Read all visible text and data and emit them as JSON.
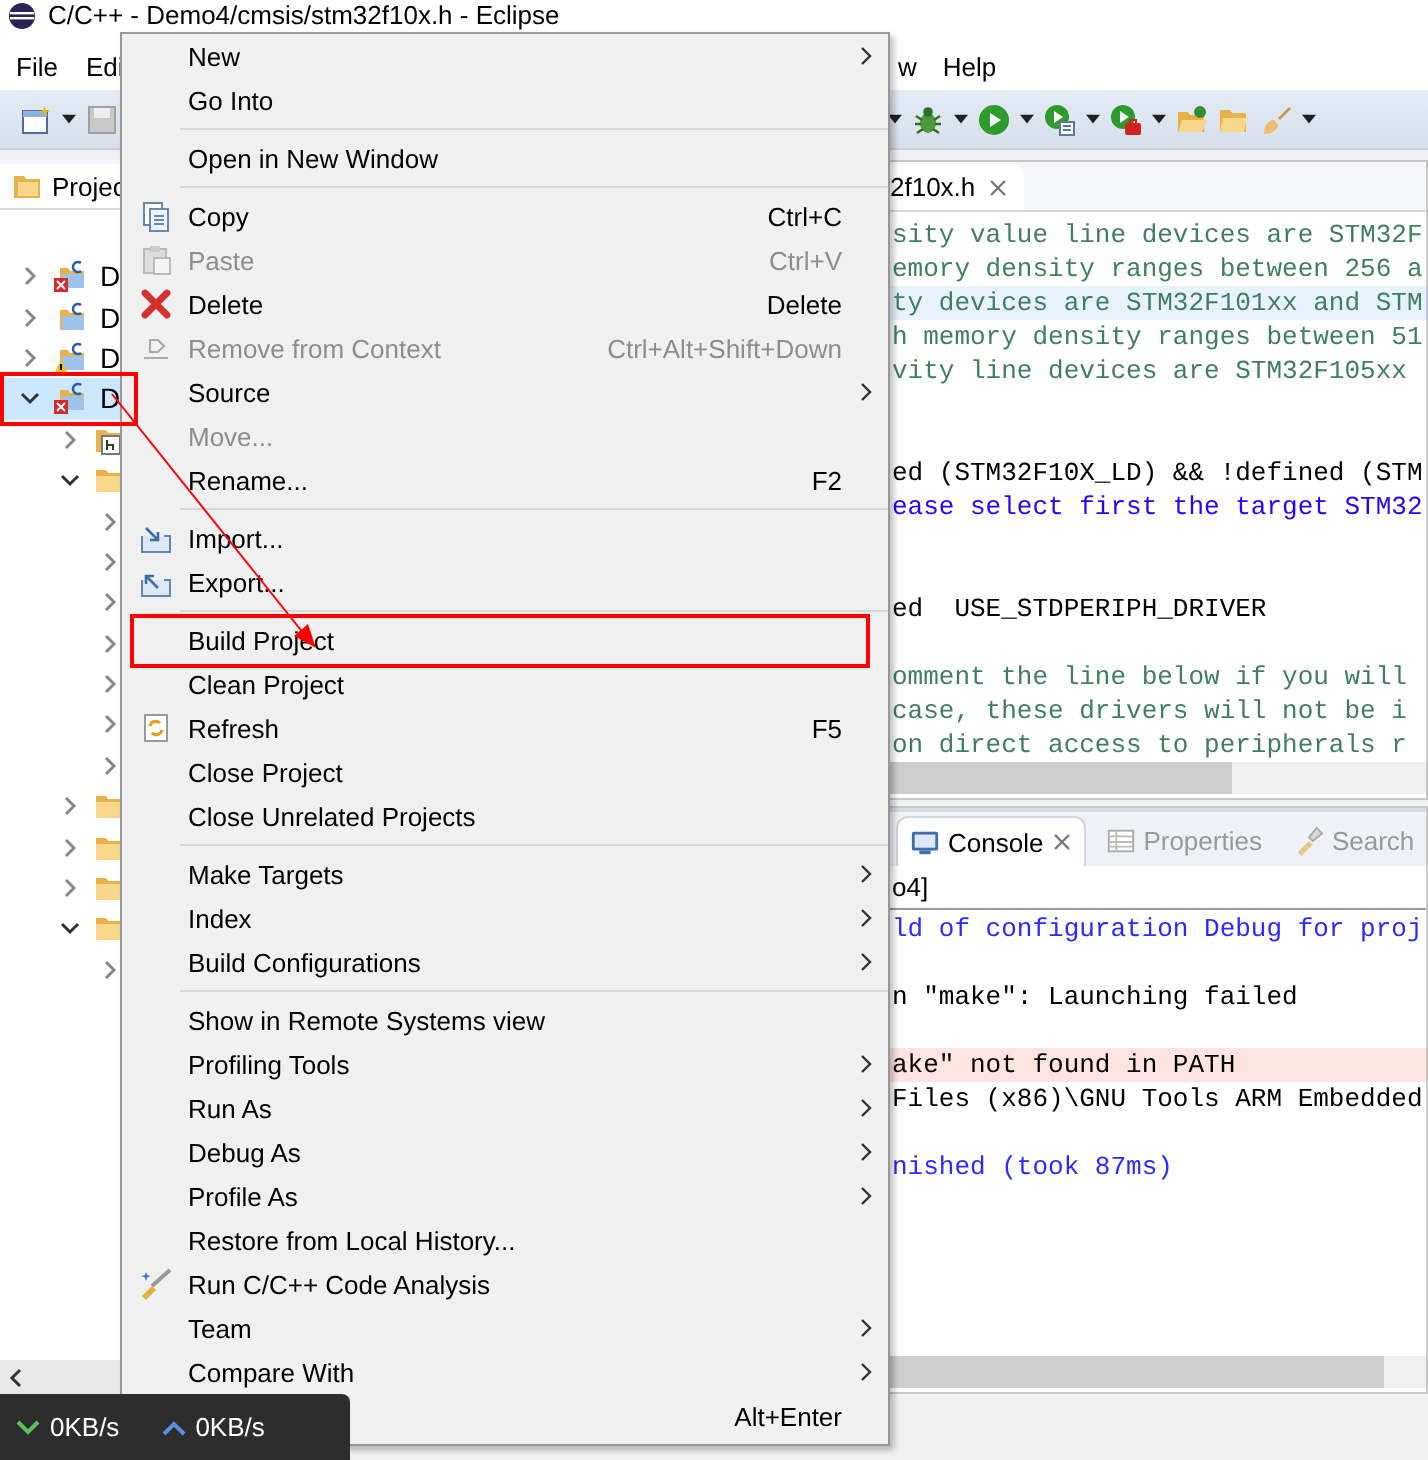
{
  "window": {
    "title": "C/C++ - Demo4/cmsis/stm32f10x.h - Eclipse"
  },
  "menu_bar": {
    "left": [
      "File",
      "Edi"
    ],
    "right": [
      "w",
      "Help"
    ]
  },
  "project_explorer": {
    "tab": "Projec",
    "tree": [
      {
        "label": "D",
        "kind": "project",
        "errors": true,
        "warnings": false,
        "expanded": false,
        "selected": false
      },
      {
        "label": "D",
        "kind": "project",
        "errors": false,
        "warnings": false,
        "expanded": false,
        "selected": false
      },
      {
        "label": "D",
        "kind": "project",
        "errors": false,
        "warnings": true,
        "expanded": false,
        "selected": false
      },
      {
        "label": "D",
        "kind": "project",
        "errors": true,
        "warnings": false,
        "expanded": true,
        "selected": true,
        "children": [
          {
            "kind": "includes",
            "expanded": false,
            "selected": false
          },
          {
            "kind": "folder",
            "expanded": true,
            "selected": false,
            "children": [
              {
                "expanded": false,
                "selected": false
              },
              {
                "expanded": false,
                "selected": false
              },
              {
                "expanded": false,
                "selected": false
              },
              {
                "expanded": false,
                "selected": false
              },
              {
                "expanded": false,
                "selected": false
              },
              {
                "expanded": false,
                "selected": false
              },
              {
                "expanded": false,
                "selected": false
              }
            ]
          },
          {
            "kind": "folder",
            "expanded": false,
            "selected": false
          },
          {
            "kind": "folder",
            "expanded": false,
            "selected": false
          },
          {
            "kind": "folder",
            "expanded": false,
            "selected": false
          },
          {
            "kind": "folder",
            "expanded": true,
            "selected": false,
            "children": [
              {
                "expanded": false,
                "selected": false
              }
            ]
          }
        ]
      }
    ]
  },
  "editor": {
    "tab": "2f10x.h",
    "lines": [
      {
        "kind": "comment",
        "text": "sity value line devices are STM32F",
        "highlighted": false
      },
      {
        "kind": "comment",
        "text": "emory density ranges between 256 a",
        "highlighted": false
      },
      {
        "kind": "comment",
        "text": "ty devices are STM32F101xx and STM",
        "highlighted": true
      },
      {
        "kind": "comment",
        "text": "h memory density ranges between 51",
        "highlighted": false
      },
      {
        "kind": "comment",
        "text": "vity line devices are STM32F105xx",
        "highlighted": false
      },
      {
        "kind": "blank"
      },
      {
        "kind": "blank"
      },
      {
        "kind": "code",
        "text": "ed (STM32F10X_LD) && !defined (STM",
        "highlighted": false
      },
      {
        "kind": "string",
        "text": "ease select first the target STM32",
        "highlighted": false
      },
      {
        "kind": "blank"
      },
      {
        "kind": "blank"
      },
      {
        "kind": "code",
        "text": "ed  USE_STDPERIPH_DRIVER",
        "highlighted": false
      },
      {
        "kind": "blank"
      },
      {
        "kind": "comment",
        "text": "omment the line below if you will",
        "highlighted": false
      },
      {
        "kind": "comment",
        "text": "case, these drivers will not be i",
        "highlighted": false
      },
      {
        "kind": "comment",
        "text": "on direct access to peripherals r",
        "highlighted": false
      }
    ]
  },
  "console": {
    "tabs": [
      {
        "label": "Console",
        "selected": true
      },
      {
        "label": "Properties",
        "selected": false
      },
      {
        "label": "Search",
        "selected": false
      }
    ],
    "header": "o4]",
    "lines": [
      {
        "kind": "info",
        "text": "ld of configuration Debug for proj"
      },
      {
        "kind": "blank"
      },
      {
        "kind": "normal",
        "text": "n \"make\": Launching failed"
      },
      {
        "kind": "blank"
      },
      {
        "kind": "error",
        "text": "ake\" not found in PATH"
      },
      {
        "kind": "normal",
        "text": "Files (x86)\\GNU Tools ARM Embedded"
      },
      {
        "kind": "blank"
      },
      {
        "kind": "info",
        "text": "nished (took 87ms)"
      }
    ]
  },
  "context_menu": [
    {
      "kind": "item",
      "label": "New",
      "submenu": true,
      "disabled": false
    },
    {
      "kind": "item",
      "label": "Go Into",
      "submenu": false,
      "disabled": false
    },
    {
      "kind": "separator"
    },
    {
      "kind": "item",
      "label": "Open in New Window",
      "submenu": false,
      "disabled": false
    },
    {
      "kind": "separator"
    },
    {
      "kind": "item",
      "label": "Copy",
      "shortcut": "Ctrl+C",
      "submenu": false,
      "disabled": false
    },
    {
      "kind": "item",
      "label": "Paste",
      "shortcut": "Ctrl+V",
      "submenu": false,
      "disabled": true
    },
    {
      "kind": "item",
      "label": "Delete",
      "shortcut": "Delete",
      "submenu": false,
      "disabled": false
    },
    {
      "kind": "item",
      "label": "Remove from Context",
      "shortcut": "Ctrl+Alt+Shift+Down",
      "submenu": false,
      "disabled": true
    },
    {
      "kind": "item",
      "label": "Source",
      "submenu": true,
      "disabled": false
    },
    {
      "kind": "item",
      "label": "Move...",
      "submenu": false,
      "disabled": true
    },
    {
      "kind": "item",
      "label": "Rename...",
      "shortcut": "F2",
      "submenu": false,
      "disabled": false
    },
    {
      "kind": "separator"
    },
    {
      "kind": "item",
      "label": "Import...",
      "submenu": false,
      "disabled": false
    },
    {
      "kind": "item",
      "label": "Export...",
      "submenu": false,
      "disabled": false
    },
    {
      "kind": "separator"
    },
    {
      "kind": "item",
      "label": "Build Project",
      "submenu": false,
      "disabled": false
    },
    {
      "kind": "item",
      "label": "Clean Project",
      "submenu": false,
      "disabled": false
    },
    {
      "kind": "item",
      "label": "Refresh",
      "shortcut": "F5",
      "submenu": false,
      "disabled": false
    },
    {
      "kind": "item",
      "label": "Close Project",
      "submenu": false,
      "disabled": false
    },
    {
      "kind": "item",
      "label": "Close Unrelated Projects",
      "submenu": false,
      "disabled": false
    },
    {
      "kind": "separator"
    },
    {
      "kind": "item",
      "label": "Make Targets",
      "submenu": true,
      "disabled": false
    },
    {
      "kind": "item",
      "label": "Index",
      "submenu": true,
      "disabled": false
    },
    {
      "kind": "item",
      "label": "Build Configurations",
      "submenu": true,
      "disabled": false
    },
    {
      "kind": "separator"
    },
    {
      "kind": "item",
      "label": "Show in Remote Systems view",
      "submenu": false,
      "disabled": false
    },
    {
      "kind": "item",
      "label": "Profiling Tools",
      "submenu": true,
      "disabled": false
    },
    {
      "kind": "item",
      "label": "Run As",
      "submenu": true,
      "disabled": false
    },
    {
      "kind": "item",
      "label": "Debug As",
      "submenu": true,
      "disabled": false
    },
    {
      "kind": "item",
      "label": "Profile As",
      "submenu": true,
      "disabled": false
    },
    {
      "kind": "item",
      "label": "Restore from Local History...",
      "submenu": false,
      "disabled": false
    },
    {
      "kind": "item",
      "label": "Run C/C++ Code Analysis",
      "submenu": false,
      "disabled": false
    },
    {
      "kind": "item",
      "label": "Team",
      "submenu": true,
      "disabled": false
    },
    {
      "kind": "item",
      "label": "Compare With",
      "submenu": true,
      "disabled": false
    },
    {
      "kind": "item",
      "shortcut": "Alt+Enter",
      "submenu": false,
      "disabled": false
    }
  ],
  "net_speed": {
    "download": "0KB/s",
    "upload": "0KB/s"
  }
}
